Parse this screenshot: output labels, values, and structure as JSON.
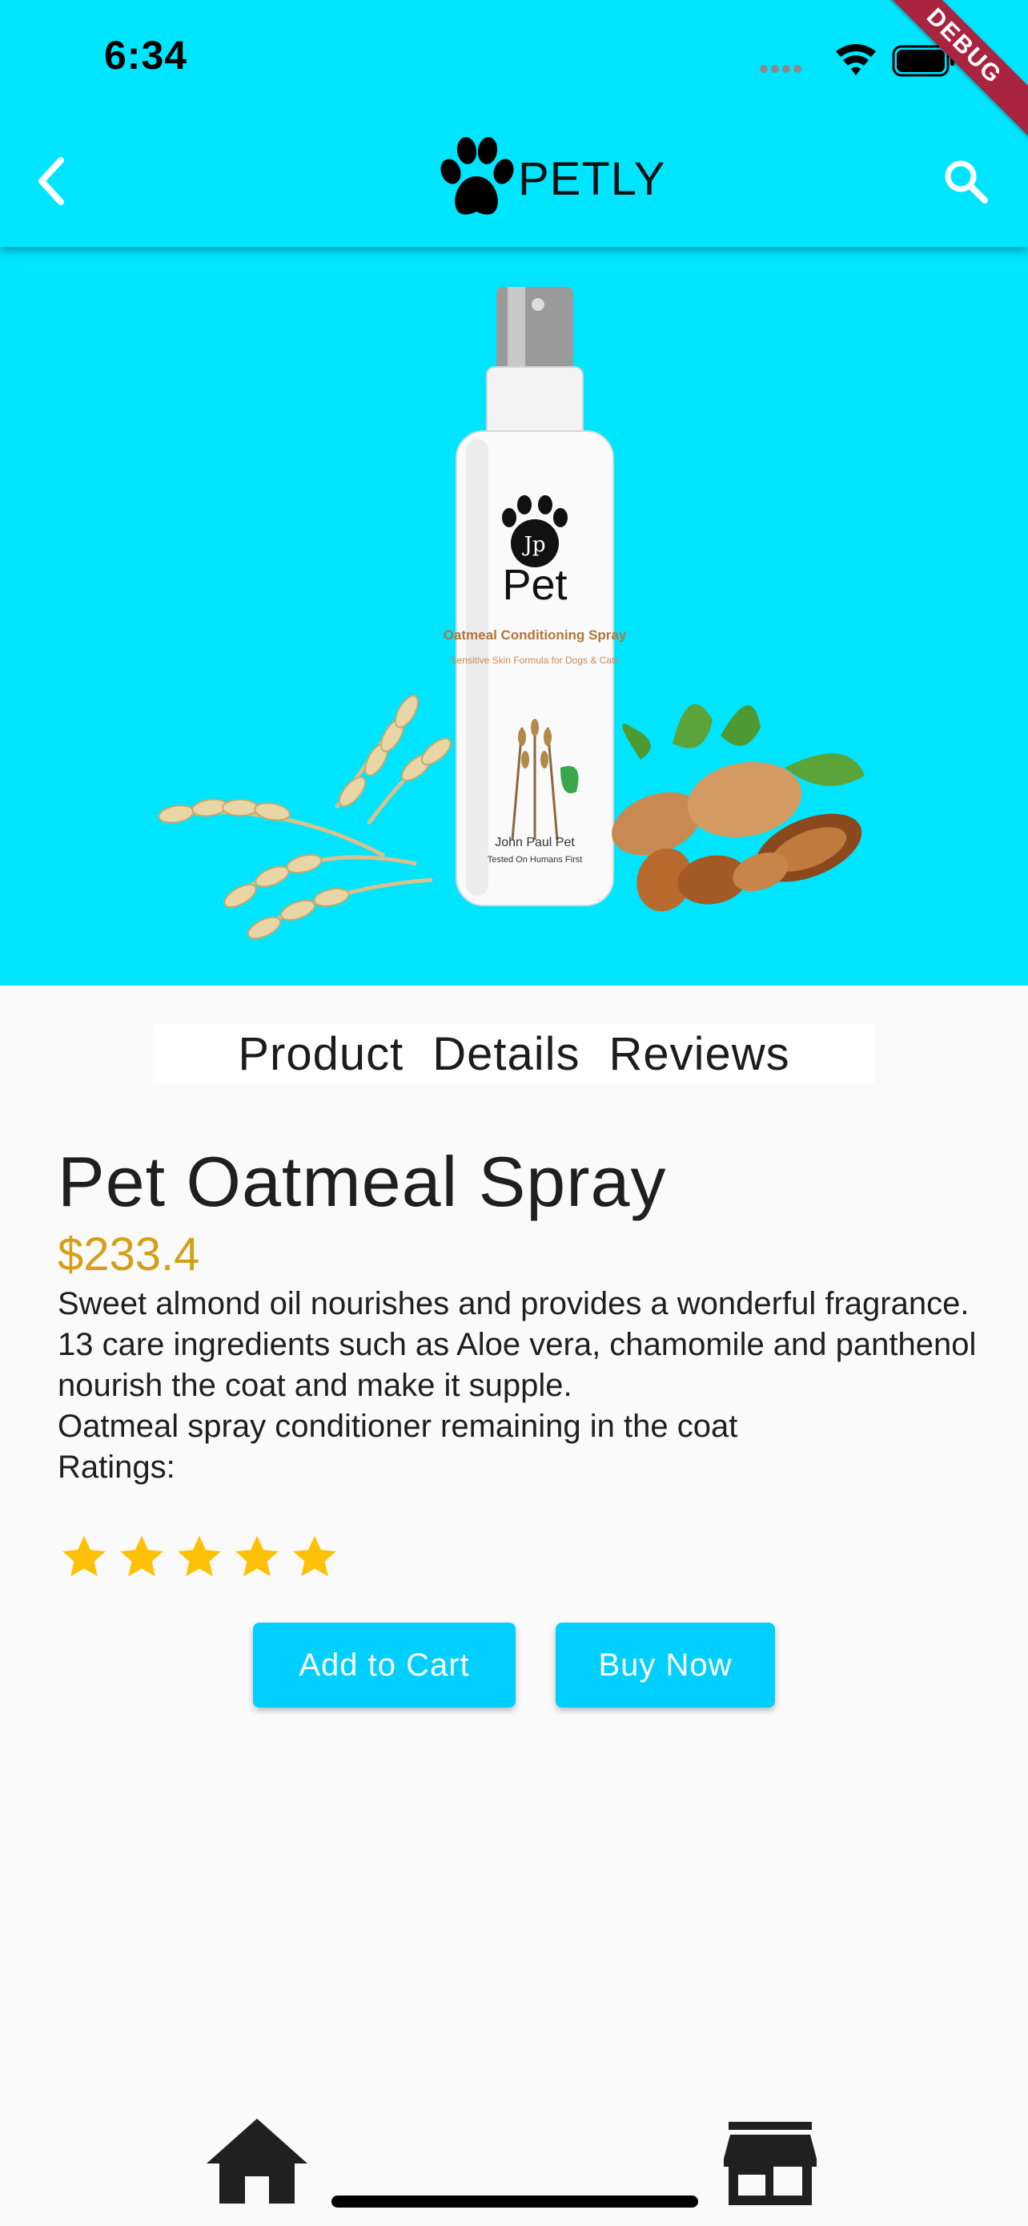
{
  "status_bar": {
    "time": "6:34",
    "debug_label": "DEBUG"
  },
  "app_bar": {
    "brand": "PETLY",
    "back_icon": "chevron-left-icon",
    "search_icon": "search-icon",
    "logo_icon": "paw-icon"
  },
  "hero": {
    "product_label_brand": "Pet",
    "product_label_name": "Oatmeal Conditioning Spray",
    "product_label_sub": "Sensitive Skin Formula for Dogs & Cats",
    "product_label_maker": "John Paul Pet",
    "product_label_tag": "Tested On Humans First"
  },
  "tabs": [
    "Product",
    "Details",
    "Reviews"
  ],
  "product": {
    "title": "Pet Oatmeal Spray",
    "price": "$233.4",
    "description": [
      "Sweet almond oil nourishes and provides a wonderful fragrance.",
      "13 care ingredients such as Aloe vera, chamomile and panthenol nourish the coat and make it supple.",
      "Oatmeal spray conditioner remaining in the coat"
    ],
    "ratings_label": "Ratings:",
    "rating": 5,
    "rating_max": 5
  },
  "actions": {
    "add_to_cart": "Add to Cart",
    "buy_now": "Buy Now"
  },
  "bottom_nav": {
    "home_icon": "home-icon",
    "store_icon": "store-icon"
  },
  "colors": {
    "accent": "#00e5ff",
    "button": "#00cfff",
    "price": "#d4a017",
    "star": "#ffc107"
  }
}
